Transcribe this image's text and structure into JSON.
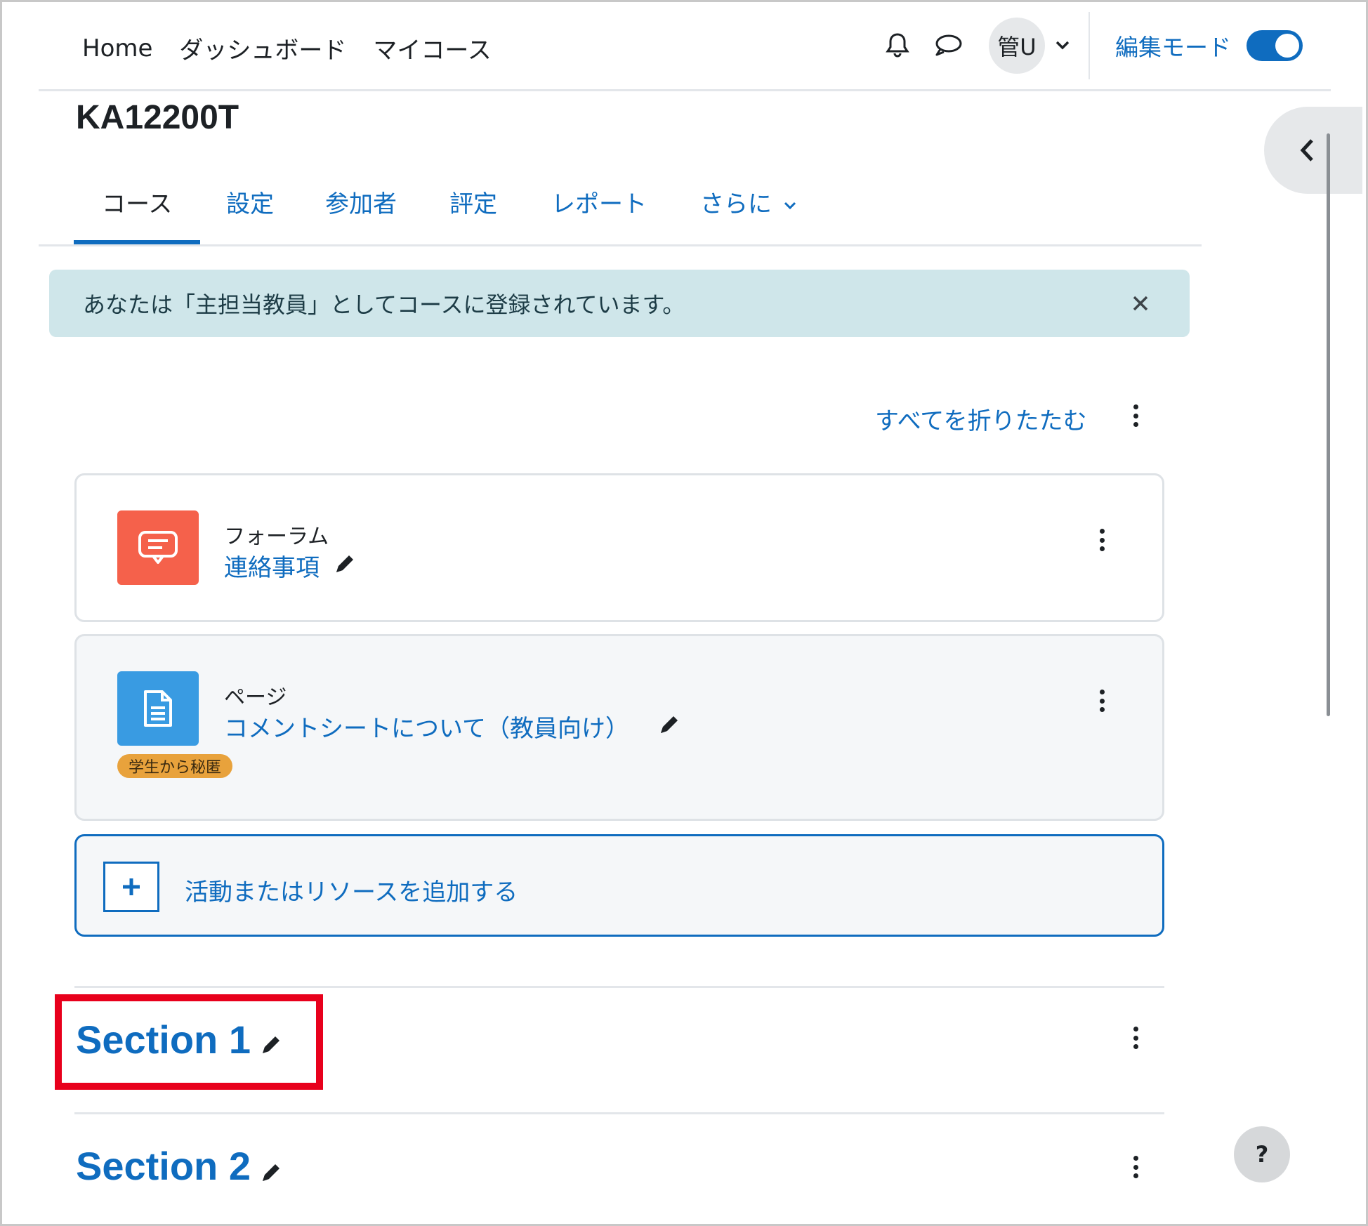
{
  "nav": {
    "links": [
      "Home",
      "ダッシュボード",
      "マイコース"
    ],
    "avatar_initials": "管U",
    "edit_mode_label": "編集モード",
    "edit_mode_on": true
  },
  "course": {
    "title": "KA12200T",
    "tabs": [
      "コース",
      "設定",
      "参加者",
      "評定",
      "レポート",
      "さらに"
    ],
    "active_tab": "コース"
  },
  "alert": {
    "text": "あなたは「主担当教員」としてコースに登録されています。"
  },
  "collapse_all_label": "すべてを折りたたむ",
  "activities": [
    {
      "type": "フォーラム",
      "name": "連絡事項",
      "icon": "forum-icon",
      "color": "#f5614b"
    },
    {
      "type": "ページ",
      "name": "コメントシートについて（教員向け）",
      "icon": "page-icon",
      "color": "#399be2",
      "badge": "学生から秘匿"
    }
  ],
  "add_activity_label": "活動またはリソースを追加する",
  "sections": [
    {
      "title": "Section 1"
    },
    {
      "title": "Section 2"
    }
  ],
  "help_label": "?",
  "colors": {
    "link": "#0f6cbf",
    "alert_bg": "#cfe6ea",
    "highlight": "#e8001c"
  }
}
